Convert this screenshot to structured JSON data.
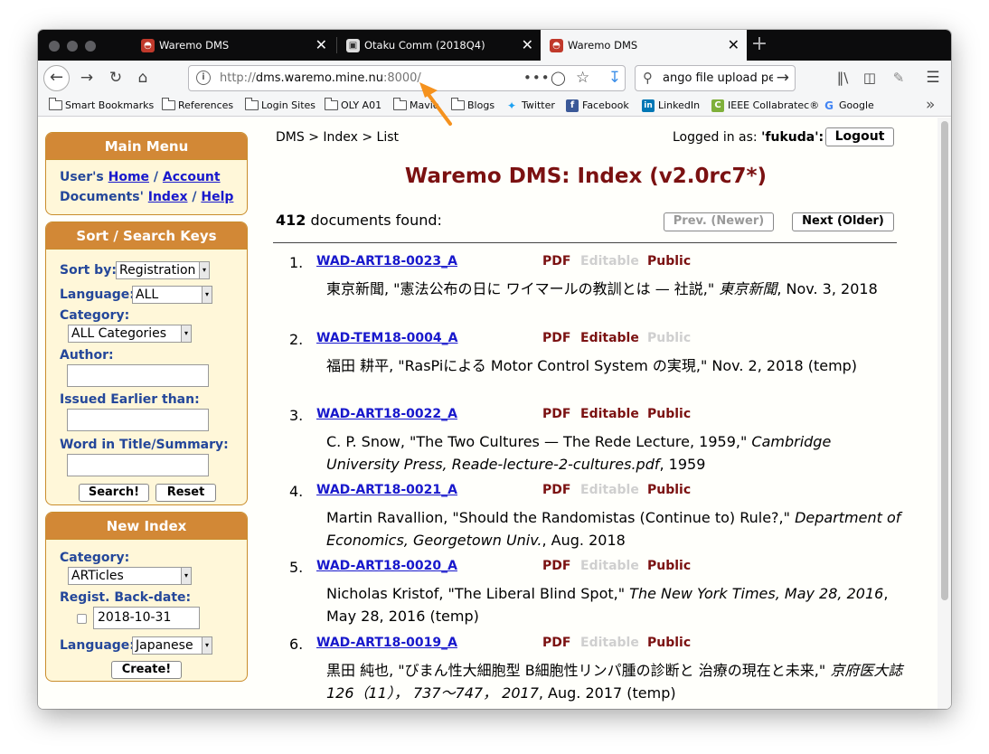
{
  "browser": {
    "tabs": [
      {
        "title": "Waremo DMS",
        "favicon": "waremo-favicon",
        "active": false
      },
      {
        "title": "Otaku Comm (2018Q4)",
        "favicon": "otaku-favicon",
        "active": false
      },
      {
        "title": "Waremo DMS",
        "favicon": "waremo-favicon",
        "active": true
      }
    ],
    "new_tab": "+",
    "url_prefix": "http://",
    "url_host": "dms.waremo.mine.nu",
    "url_suffix": ":8000/",
    "search_text": "ango file upload pe",
    "bookmarks": [
      {
        "label": "Smart Bookmarks",
        "icon": "folder-icon"
      },
      {
        "label": "References",
        "icon": "folder-icon"
      },
      {
        "label": "Login Sites",
        "icon": "folder-icon"
      },
      {
        "label": "OLY A01",
        "icon": "folder-icon"
      },
      {
        "label": "Mavie",
        "icon": "folder-icon"
      },
      {
        "label": "Blogs",
        "icon": "folder-icon"
      },
      {
        "label": "Twitter",
        "icon": "twitter-icon"
      },
      {
        "label": "Facebook",
        "icon": "facebook-icon"
      },
      {
        "label": "LinkedIn",
        "icon": "linkedin-icon"
      },
      {
        "label": "IEEE Collabratec®",
        "icon": "ieee-icon"
      },
      {
        "label": "Google",
        "icon": "google-icon"
      }
    ]
  },
  "sidebar": {
    "main_menu": {
      "title": "Main Menu",
      "users_label": "User's",
      "home": "Home",
      "sep1": "/",
      "account": "Account",
      "documents_label": "Documents'",
      "index": "Index",
      "sep2": "/",
      "help": "Help"
    },
    "sort_search": {
      "title": "Sort / Search Keys",
      "sort_by_label": "Sort by:",
      "sort_by_value": "Registration",
      "language_label": "Language:",
      "language_value": "ALL",
      "category_label": "Category:",
      "category_value": "ALL Categories",
      "author_label": "Author:",
      "author_value": "",
      "issued_label": "Issued Earlier than:",
      "issued_value": "",
      "word_label": "Word in Title/Summary:",
      "word_value": "",
      "search_button": "Search!",
      "reset_button": "Reset"
    },
    "new_index": {
      "title": "New Index",
      "category_label": "Category:",
      "category_value": "ARTicles",
      "backdate_label": "Regist. Back-date:",
      "backdate_value": "2018-10-31",
      "language_label": "Language:",
      "language_value": "Japanese",
      "create_button": "Create!"
    }
  },
  "main": {
    "breadcrumb": "DMS > Index > List",
    "logged_in_label": "Logged in as:",
    "logged_in_user": "'fukuda':",
    "logout_button": "Logout",
    "title": "Waremo DMS: Index (v2.0rc7*)",
    "count": "412",
    "count_suffix": "documents found:",
    "prev_button": "Prev. (Newer)",
    "next_button": "Next (Older)",
    "documents": [
      {
        "num": "1.",
        "id": "WAD-ART18-0023_A",
        "pdf": "PDF",
        "editable": "Editable",
        "public": "Public",
        "pdf_on": true,
        "editable_on": false,
        "public_on": true,
        "d1": "東京新聞, \"憲法公布の日に ワイマールの教訓とは — 社説,\" ",
        "d_italic": "東京新聞",
        "d2": ", Nov. 3, 2018"
      },
      {
        "num": "2.",
        "id": "WAD-TEM18-0004_A",
        "pdf": "PDF",
        "editable": "Editable",
        "public": "Public",
        "pdf_on": true,
        "editable_on": true,
        "public_on": false,
        "d1": "福田 耕平, \"RasPiによる Motor Control System の実現,\" Nov. 2, 2018 (temp)",
        "d_italic": "",
        "d2": ""
      },
      {
        "num": "3.",
        "id": "WAD-ART18-0022_A",
        "pdf": "PDF",
        "editable": "Editable",
        "public": "Public",
        "pdf_on": true,
        "editable_on": true,
        "public_on": true,
        "d1": "C. P. Snow, \"The Two Cultures — The Rede Lecture, 1959,\" ",
        "d_italic": "Cambridge University Press, Reade-lecture-2-cultures.pdf",
        "d2": ", 1959"
      },
      {
        "num": "4.",
        "id": "WAD-ART18-0021_A",
        "pdf": "PDF",
        "editable": "Editable",
        "public": "Public",
        "pdf_on": true,
        "editable_on": false,
        "public_on": true,
        "d1": "Martin Ravallion, \"Should the Randomistas (Continue to) Rule?,\" ",
        "d_italic": "Department of Economics, Georgetown Univ.",
        "d2": ", Aug. 2018"
      },
      {
        "num": "5.",
        "id": "WAD-ART18-0020_A",
        "pdf": "PDF",
        "editable": "Editable",
        "public": "Public",
        "pdf_on": true,
        "editable_on": false,
        "public_on": true,
        "d1": "Nicholas Kristof, \"The Liberal Blind Spot,\" ",
        "d_italic": "The New York Times, May 28, 2016",
        "d2": ", May 28, 2016 (temp)"
      },
      {
        "num": "6.",
        "id": "WAD-ART18-0019_A",
        "pdf": "PDF",
        "editable": "Editable",
        "public": "Public",
        "pdf_on": true,
        "editable_on": false,
        "public_on": true,
        "d1": "黒田 純也, \"びまん性大細胞型 B細胞性リンパ腫の診断と 治療の現在と未来,\" ",
        "d_italic": "京府医大誌 126（11）， 737〜747， 2017",
        "d2": ", Aug. 2017 (temp)"
      }
    ]
  },
  "colors": {
    "panel_header": "#d28836",
    "panel_bg": "#fff7d9",
    "title": "#7b1111",
    "link": "#1818cc",
    "label": "#24479a",
    "annotation_arrow": "#f5921e"
  }
}
